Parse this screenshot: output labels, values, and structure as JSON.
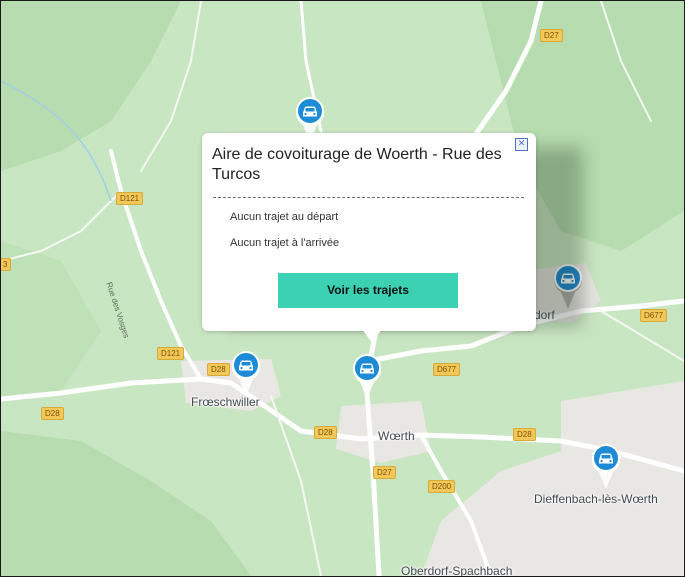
{
  "colors": {
    "land": "#c9e6c2",
    "forest": "#b4dbae",
    "town": "#e9e7e3",
    "road_major": "#ffffff",
    "road_badge": "#f3c85a",
    "pin_blue": "#1e8bd6",
    "pin_gray": "#a9a9a9",
    "button_teal": "#3dd1b4",
    "close_blue": "#4d6fc7"
  },
  "road_labels": [
    {
      "id": "d27-north",
      "text": "D27"
    },
    {
      "id": "d121-west",
      "text": "D121"
    },
    {
      "id": "d121-south",
      "text": "D121"
    },
    {
      "id": "d28-west",
      "text": "D28"
    },
    {
      "id": "d28-center",
      "text": "D28"
    },
    {
      "id": "d28-pin",
      "text": "D28"
    },
    {
      "id": "d28-east",
      "text": "D28"
    },
    {
      "id": "d677-center",
      "text": "D677"
    },
    {
      "id": "d677-east",
      "text": "D677"
    },
    {
      "id": "d27-south",
      "text": "D27"
    },
    {
      "id": "d200",
      "text": "D200"
    },
    {
      "id": "d-edge",
      "text": "3"
    }
  ],
  "places": {
    "froeschwiller": "Frœschwiller",
    "woerth": "Wœrth",
    "dieffenbach": "Dieffenbach-lès-Wœrth",
    "oberdorf": "Oberdorf-Spachbach",
    "dorf_partial": "dorf"
  },
  "streets": {
    "rue_des_vosges": "Rue des Vosges"
  },
  "markers": {
    "icon": "car-icon",
    "items": [
      "north",
      "froeschwiller",
      "woerth",
      "east",
      "dieffenbach"
    ]
  },
  "popup": {
    "title": "Aire de covoiturage de Woerth - Rue des Turcos",
    "close_label": "✕",
    "departures": "Aucun trajet au départ",
    "arrivals": "Aucun trajet à l'arrivée",
    "button_label": "Voir les trajets"
  }
}
